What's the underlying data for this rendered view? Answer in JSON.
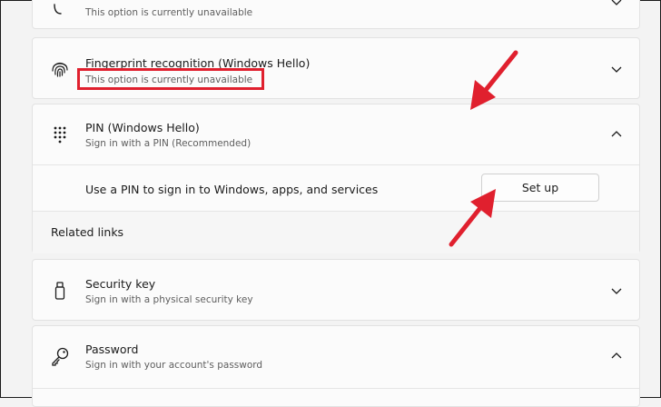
{
  "sign_in_options": {
    "top_partial": {
      "subtitle": "This option is currently unavailable",
      "icon": "face-icon"
    },
    "fingerprint": {
      "title": "Fingerprint recognition (Windows Hello)",
      "subtitle": "This option is currently unavailable",
      "icon": "fingerprint-icon"
    },
    "pin": {
      "title": "PIN (Windows Hello)",
      "subtitle": "Sign in with a PIN (Recommended)",
      "icon": "keypad-icon",
      "expanded_text": "Use a PIN to sign in to Windows, apps, and services",
      "setup_button": "Set up",
      "related_links": "Related links"
    },
    "security_key": {
      "title": "Security key",
      "subtitle": "Sign in with a physical security key",
      "icon": "usb-key-icon"
    },
    "password": {
      "title": "Password",
      "subtitle": "Sign in with your account's password",
      "icon": "key-icon"
    }
  },
  "annotation": {
    "highlight_color": "#e0202e",
    "arrow_color": "#e0202e"
  }
}
